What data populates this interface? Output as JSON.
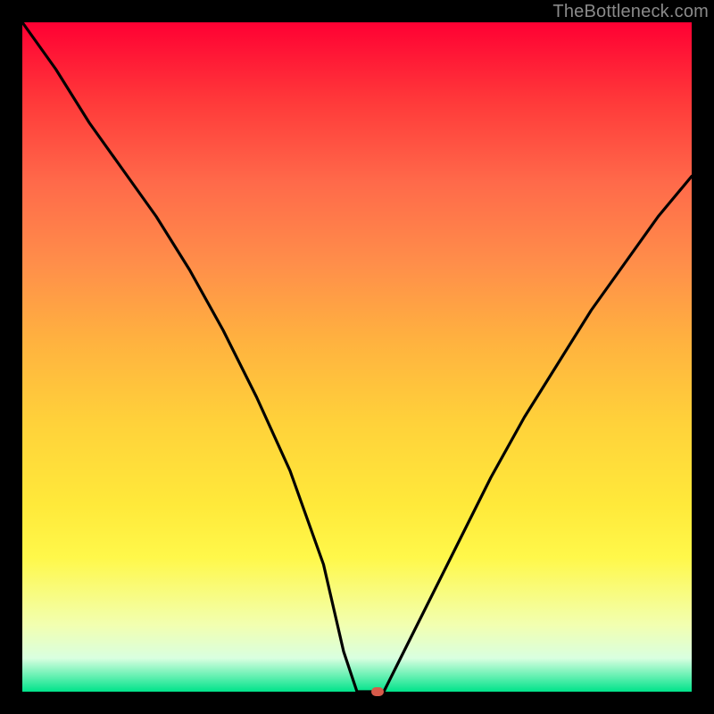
{
  "watermark": "TheBottleneck.com",
  "colors": {
    "gradient_top": "#ff0033",
    "gradient_mid": "#ffd23a",
    "gradient_bottom": "#00e38a",
    "curve": "#000000",
    "marker": "#d65a4a",
    "background": "#000000"
  },
  "chart_data": {
    "type": "line",
    "title": "",
    "xlabel": "",
    "ylabel": "",
    "xlim": [
      0,
      100
    ],
    "ylim": [
      0,
      100
    ],
    "grid": false,
    "legend": false,
    "series": [
      {
        "name": "bottleneck-curve",
        "x": [
          0,
          5,
          10,
          15,
          20,
          25,
          30,
          35,
          40,
          45,
          48,
          50,
          52,
          54,
          56,
          60,
          65,
          70,
          75,
          80,
          85,
          90,
          95,
          100
        ],
        "y": [
          100,
          93,
          85,
          78,
          71,
          63,
          54,
          44,
          33,
          19,
          6,
          0,
          0,
          0,
          4,
          12,
          22,
          32,
          41,
          49,
          57,
          64,
          71,
          77
        ]
      }
    ],
    "marker": {
      "x": 53,
      "y": 0
    }
  }
}
